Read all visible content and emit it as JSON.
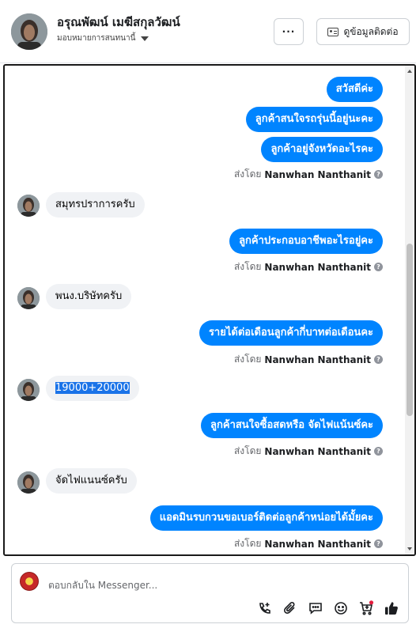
{
  "header": {
    "contact_name": "อรุณพัฒน์ เมฆีสกุลวัฒน์",
    "assign_label": "มอบหมายการสนทนานี้",
    "more_label": "···",
    "contact_info_label": "ดูข้อมูลติดต่อ"
  },
  "thread": {
    "messages": [
      {
        "dir": "out",
        "text": "สวัสดีค่ะ"
      },
      {
        "dir": "out",
        "text": "ลูกค้าสนใจรถรุ่นนี้อยู่นะคะ"
      },
      {
        "dir": "out",
        "text": "ลูกค้าอยู่จังหวัดอะไรคะ"
      },
      {
        "dir": "in",
        "text": "สมุทรปราการครับ"
      },
      {
        "dir": "out",
        "text": "ลูกค้าประกอบอาชีพอะไรอยู่คะ"
      },
      {
        "dir": "in",
        "text": "พนง.บริษัทครับ"
      },
      {
        "dir": "out",
        "text": "รายได้ต่อเดือนลูกค้ากี่บาทต่อเดือนคะ"
      },
      {
        "dir": "in",
        "text": "19000+20000"
      },
      {
        "dir": "out",
        "text": "ลูกค้าสนใจซื้อสดหรือ จัดไฟแน้นซ์คะ"
      },
      {
        "dir": "in",
        "text": "จัดไฟแนนซ์ครับ"
      },
      {
        "dir": "out",
        "text": "แอดมินรบกวนขอเบอร์ติดต่อลูกค้าหน่อยได้มั้ยคะ"
      }
    ],
    "sent_by_prefix": "ส่งโดย",
    "sent_by_name": "Nanwhan Nanthanit",
    "info_glyph": "?"
  },
  "composer": {
    "placeholder": "ตอบกลับใน Messenger...",
    "tools": [
      "call-add-icon",
      "attachment-icon",
      "saved-replies-icon",
      "emoji-icon",
      "cart-icon",
      "like-icon"
    ]
  },
  "colors": {
    "outgoing_bubble": "#0084ff",
    "incoming_bubble": "#f0f2f5",
    "highlight": "#1a73e8",
    "notification_dot": "#e41e3f"
  }
}
